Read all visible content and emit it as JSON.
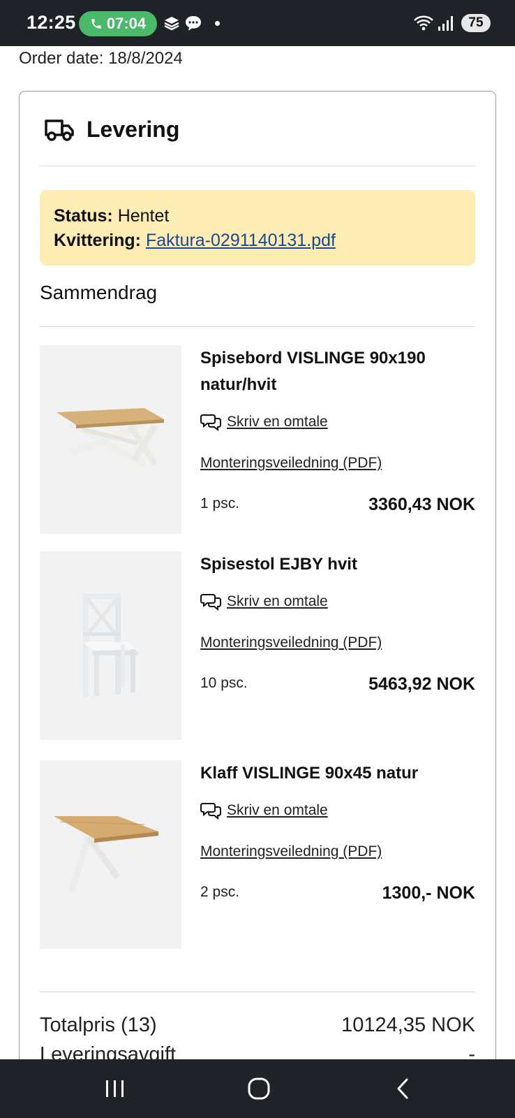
{
  "status_bar": {
    "time": "12:25",
    "call_timer": "07:04",
    "battery": "75",
    "signal_icon": "wifi-icon",
    "accent": "#4bb96a"
  },
  "order": {
    "date_label": "Order date: 18/8/2024"
  },
  "delivery": {
    "title": "Levering",
    "status_label": "Status:",
    "status_value": "Hentet",
    "receipt_label": "Kvittering:",
    "receipt_link": "Faktura-0291140131.pdf",
    "status_bg": "#fdecb4"
  },
  "summary": {
    "title": "Sammendrag",
    "items": [
      {
        "name": "Spisebord VISLINGE 90x190 natur/hvit",
        "review": "Skriv en omtale",
        "manual": "Monteringsveiledning (PDF)",
        "qty": "1 psc.",
        "price": "3360,43 NOK"
      },
      {
        "name": "Spisestol EJBY hvit",
        "review": "Skriv en omtale",
        "manual": "Monteringsveiledning (PDF)",
        "qty": "10 psc.",
        "price": "5463,92 NOK"
      },
      {
        "name": "Klaff VISLINGE 90x45 natur",
        "review": "Skriv en omtale",
        "manual": "Monteringsveiledning (PDF)",
        "qty": "2 psc.",
        "price": "1300,- NOK"
      }
    ],
    "total_label": "Totalpris (13)",
    "total_value": "10124,35 NOK",
    "fee_label": "Leveringsavgift",
    "fee_value": "-"
  }
}
